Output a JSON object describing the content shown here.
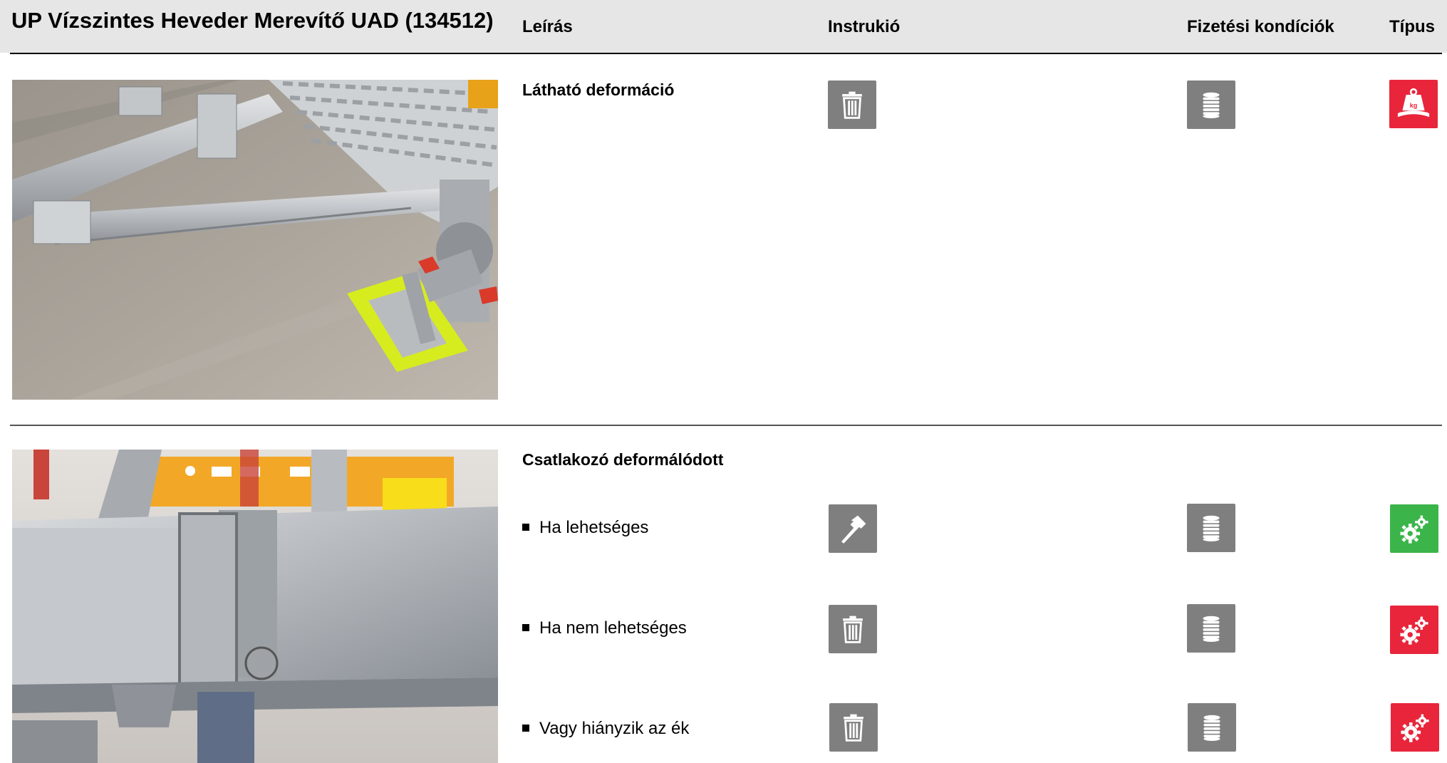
{
  "header": {
    "title": "UP Vízszintes Heveder Merevítő UAD (134512)",
    "col_description": "Leírás",
    "col_instruction": "Instrukió",
    "col_payment": "Fizetési kondíciók",
    "col_type": "Típus"
  },
  "rows": [
    {
      "photo_icon": "scaffold-ledger-brace-photo",
      "heading": "Látható deformáció",
      "instruction_icon": "trash-icon",
      "payment_icon": "coin-stack-icon",
      "type_icon": "weight-kg-icon",
      "type_color": "#e8253b"
    },
    {
      "photo_icon": "connector-closeup-photo",
      "heading": "Csatlakozó deformálódott",
      "items": [
        {
          "label": "Ha lehetséges",
          "instruction_icon": "hammer-icon",
          "payment_icon": "coin-stack-icon",
          "type_icon": "gears-icon",
          "type_color": "#3bb54a"
        },
        {
          "label": "Ha nem lehetséges",
          "instruction_icon": "trash-icon",
          "payment_icon": "coin-stack-icon",
          "type_icon": "gears-icon",
          "type_color": "#e8253b"
        },
        {
          "label": "Vagy hiányzik az ék",
          "instruction_icon": "trash-icon",
          "payment_icon": "coin-stack-icon",
          "type_icon": "gears-icon",
          "type_color": "#e8253b"
        }
      ]
    }
  ],
  "colors": {
    "icon_grey": "#7f7f7f",
    "header_band": "#e6e6e6"
  }
}
